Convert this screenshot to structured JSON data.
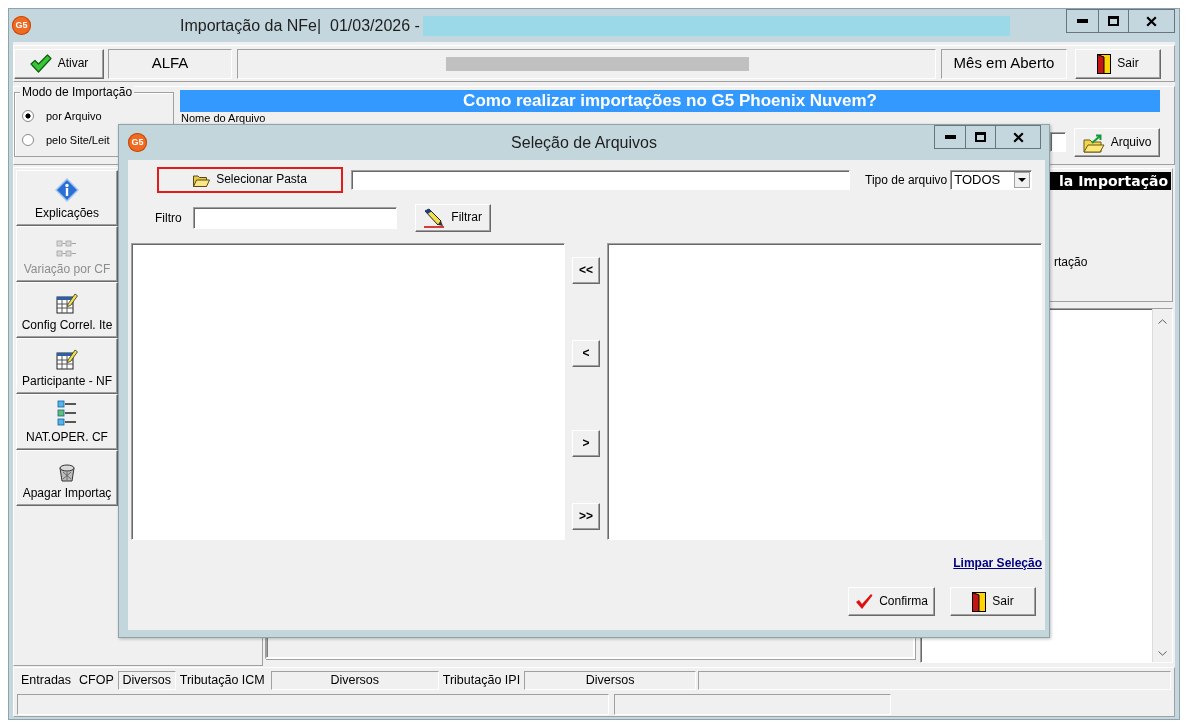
{
  "window": {
    "logo": "G5",
    "title": "Importação da NFe|  01/03/2026 -"
  },
  "toolbar": {
    "activate_button": "Ativar",
    "company": "ALFA",
    "period_status": "Mês em Aberto",
    "exit_button": "Sair"
  },
  "import_mode": {
    "title": "Modo de Importação",
    "options": [
      {
        "label": "por Arquivo",
        "selected": true
      },
      {
        "label": "pelo Site/Leit",
        "selected": false
      }
    ]
  },
  "help_banner": "Como realizar importações no G5 Phoenix Nuvem?",
  "file_name_label": "Nome do Arquivo",
  "file_button": "Arquivo",
  "sidebar": {
    "items": [
      {
        "label": "Explicações",
        "kind": "info",
        "disabled": false
      },
      {
        "label": "Variação por CF",
        "kind": "grid",
        "disabled": true
      },
      {
        "label": "Config Correl. Ite",
        "kind": "table",
        "disabled": false
      },
      {
        "label": "Participante - NF",
        "kind": "table",
        "disabled": false
      },
      {
        "label": "NAT.OPER. CF",
        "kind": "list",
        "disabled": false
      },
      {
        "label": "Apagar Importaç",
        "kind": "trash",
        "disabled": false
      }
    ]
  },
  "side_panel": {
    "header": "la Importação",
    "text": "rtação"
  },
  "status_bar": {
    "items": [
      {
        "kind": "label",
        "text": "Entradas"
      },
      {
        "kind": "label",
        "text": "CFOP"
      },
      {
        "kind": "field",
        "text": "Diversos"
      },
      {
        "kind": "label",
        "text": "Tributação ICM"
      },
      {
        "kind": "field",
        "text": "Diversos"
      },
      {
        "kind": "label",
        "text": "Tributação IPI"
      },
      {
        "kind": "field",
        "text": "Diversos"
      }
    ]
  },
  "dialog": {
    "logo": "G5",
    "title": "Seleção de Arquivos",
    "select_folder_button": {
      "label": "Selecionar Pasta",
      "highlighted": true
    },
    "file_type": {
      "label": "Tipo de arquivo",
      "value": "TODOS"
    },
    "filter": {
      "label": "Filtro"
    },
    "filter_button": "Filtrar",
    "move_buttons": [
      "<<",
      "<",
      ">",
      ">>"
    ],
    "clear_link": "Limpar Seleção",
    "confirm_button": "Confirma",
    "exit_button": "Sair"
  }
}
